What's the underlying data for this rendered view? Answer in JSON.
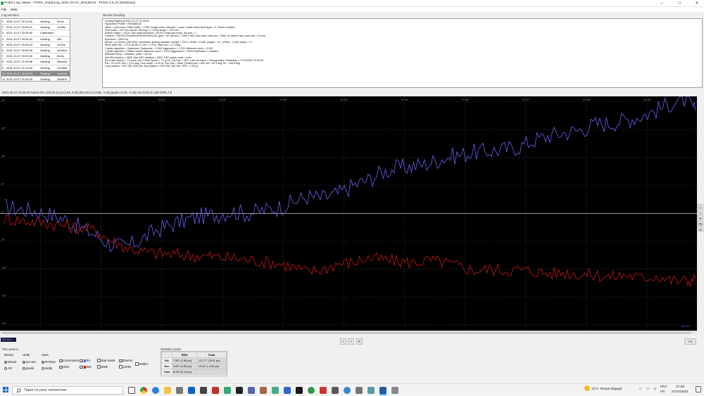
{
  "window": {
    "title": "PHD2 Log Viewer - PHD2_GuideLog_2021-10-27_201155.txt - PHD2 2.6.10 (Windows)",
    "minimize": "–",
    "maximize": "□",
    "close": "✕"
  },
  "menu": [
    "File",
    "Help"
  ],
  "log_sections": {
    "label": "Log sections",
    "rows": [
      {
        "n": "1",
        "date": "2021-10-27 20:11:46",
        "type": "Guiding",
        "dur": "5m1s"
      },
      {
        "n": "2",
        "date": "2021-10-27 20:26:41",
        "type": "Guiding",
        "dur": "1m35s"
      },
      {
        "n": "3",
        "date": "2021-10-27 20:28:40",
        "type": "Calibration",
        "dur": ""
      },
      {
        "n": "4",
        "date": "2021-10-27 20:34:31",
        "type": "Guiding",
        "dur": "46s"
      },
      {
        "n": "5",
        "date": "2021-10-27 20:35:23",
        "type": "Guiding",
        "dur": "1m13s"
      },
      {
        "n": "6",
        "date": "2021-10-27 20:36:45",
        "type": "Guiding",
        "dur": "16m31s"
      },
      {
        "n": "7",
        "date": "2021-10-27 20:53:49",
        "type": "Guiding",
        "dur": "5m2s"
      },
      {
        "n": "8",
        "date": "2021-10-27 21:00:56",
        "type": "Guiding",
        "dur": "18m43s"
      },
      {
        "n": "9",
        "date": "2021-10-27 21:12:00",
        "type": "Guiding",
        "dur": "12m58s"
      },
      {
        "n": "10",
        "date": "2021-10-27 21:28:24",
        "type": "Guiding",
        "dur": "11m24s"
      },
      {
        "n": "11",
        "date": "2021-10-27 21:40:23",
        "type": "Guiding",
        "dur": "15m57s"
      }
    ],
    "selected_index": 9
  },
  "section_heading": {
    "label": "Section heading",
    "lines": [
      "Guiding Begins at 2021-10-27 21:28:24",
      "Equipment Profile = RASA8/EAC",
      "Dither = both axes, Dither scale = 1.000, Image noise reduction = none, Guide-frame time lapse = 0, Server enabled",
      "Pixel scale = 3.87 arc-sec/px, Binning = 1, Focal length = 200 mm",
      "Search region = 15 px, Star mass tolerance = 50.0%, Multi-star mode, list size = 1",
      "Camera = QHY5LII-M (fake/ASI/ZWO/ASI120), gain = 40, full size = 1280 x 960, have dark, dark dur = 2500, no defect map, pixel size = 3.8 um",
      "Exposure = 2500 ms",
      "Mount = Un Driver (ASCOM), connected, guiding disabled, xAngle = 152.9, xRate = 0.528, yAngle = 11°, yRate = 1.444, parity = +/+",
      "Norm rates RA = 2.0\"/s @ dec 0, Dec = 0.4\"/s, offset set = 17.4 deg",
      "X guide algorithm = Hysteresis, Hysteresis = 0.000, Aggression = 0.700, Minimum move = 0.250",
      "Y guide algorithm = Resist Switch, Minimum move = 0.910 Aggression = 100% FastSwitch = enabled",
      "Backlash comp = disabled, pulse = 20 ms",
      "Max RA duration = 2500, Max DEC duration = 2500, DEC guide mode = Auto",
      "RA Guide Speed = 7.5 a-s/s, Dec Guide Speed = 7.5 a-s/s, Cal Dec = 28.0, Last Cal Issue = Orthogonality, Timestamp = 27/10/2021 20:34:30",
      "RA = 22.18 hr, Dec = 12.9 deg, Hour angle = 0.49 hr, Pier side = West, Rotator pos = N/A, Alt = 52.3 deg, Az = 169.8 deg",
      "Lock position = 597.206, 328.159, Star position = 597.206, 328.159, HFD = 2.33 px"
    ]
  },
  "chart_status": "2021-10-27 21:32:16 Frame 93 t=232.60 (x,y)=(2.84, 6.83) (RA,Dec)=(-0.66, -2.44) guide (-0.43, -2.44) corr (0.0) m=126 SNR=7.6",
  "chart_data": {
    "type": "line",
    "x_ticks": [
      "21:29",
      "21:30",
      "21:31",
      "21:32",
      "21:33",
      "21:34",
      "21:35",
      "21:36",
      "21:37",
      "21:38",
      "21:39"
    ],
    "y_ticks": [
      "20\"",
      "15\"",
      "10\"",
      "5\"",
      "0\"",
      "-5\"",
      "-10\"",
      "-15\"",
      "-20\""
    ],
    "ylim": [
      -20,
      20
    ],
    "x_range": [
      "21:28:24",
      "21:39:48"
    ],
    "grid": true,
    "series": [
      {
        "key": "RA",
        "color": "#6a62f2",
        "t_min": [
          0,
          0.25,
          0.5,
          0.75,
          1,
          1.25,
          1.5,
          1.75,
          2,
          2.25,
          2.5,
          2.75,
          3,
          3.25,
          3.5,
          3.75,
          4,
          4.25,
          4.5,
          4.75,
          5,
          5.25,
          5.5,
          5.75,
          6,
          6.25,
          6.5,
          6.75,
          7,
          7.25,
          7.5,
          7.75,
          8,
          8.25,
          8.5,
          8.75,
          9,
          9.25,
          9.5,
          9.75,
          10,
          10.25,
          10.5,
          10.75,
          11,
          11.25,
          11.4
        ],
        "values": [
          1.2,
          0.8,
          0.5,
          -0.2,
          -1.0,
          -2.5,
          -3.8,
          -5.5,
          -6.0,
          -4.8,
          -3.0,
          -2.0,
          -1.2,
          -0.5,
          -0.2,
          0.4,
          0.0,
          0.5,
          1.0,
          2.0,
          3.0,
          2.8,
          3.5,
          5.0,
          6.0,
          7.5,
          8.2,
          8.5,
          9.0,
          10.0,
          10.5,
          11.0,
          11.2,
          11.5,
          12.0,
          13.2,
          14.0,
          14.5,
          15.0,
          16.0,
          16.2,
          16.8,
          17.5,
          18.5,
          19.8,
          20.5,
          18.5
        ]
      },
      {
        "key": "Dec",
        "color": "#c81818",
        "t_min": [
          0,
          0.25,
          0.5,
          0.75,
          1,
          1.25,
          1.5,
          1.75,
          2,
          2.25,
          2.5,
          2.75,
          3,
          3.25,
          3.5,
          3.75,
          4,
          4.25,
          4.5,
          4.75,
          5,
          5.25,
          5.5,
          5.75,
          6,
          6.25,
          6.5,
          6.75,
          7,
          7.25,
          7.5,
          7.75,
          8,
          8.25,
          8.5,
          8.75,
          9,
          9.25,
          9.5,
          9.75,
          10,
          10.25,
          10.5,
          10.75,
          11,
          11.25,
          11.4
        ],
        "values": [
          -1.0,
          -1.2,
          -1.5,
          -1.8,
          -2.2,
          -2.6,
          -3.0,
          -4.8,
          -6.0,
          -6.8,
          -7.2,
          -7.3,
          -7.5,
          -7.6,
          -7.8,
          -8.0,
          -8.3,
          -8.6,
          -8.9,
          -9.6,
          -10.5,
          -10.0,
          -9.0,
          -8.8,
          -8.0,
          -8.3,
          -8.6,
          -8.8,
          -8.4,
          -8.8,
          -9.5,
          -10.2,
          -10.0,
          -10.2,
          -10.1,
          -10.4,
          -10.8,
          -10.6,
          -10.9,
          -11.0,
          -11.4,
          -11.0,
          -11.6,
          -11.2,
          -12.0,
          -12.2,
          -11.8
        ]
      }
    ]
  },
  "right_buttons": [
    "<",
    ">",
    "R",
    "P2",
    "D"
  ],
  "legend_badge": "RA Dec",
  "nav_buttons": [
    "<",
    ">",
    "R"
  ],
  "fit_button": "Fit",
  "plot_options": {
    "label": "Plot options",
    "device_label": "Device",
    "device_mount": "Mount",
    "device_ao": "AO",
    "units_label": "Units",
    "units_arcsec": "arc-sec",
    "units_pixels": "pixels",
    "axes_label": "Axes",
    "axes_radec": "RA/Dec",
    "axes_dxdy": "dx/dy",
    "corrections": "Corrections",
    "grid": "Grid",
    "ra": "RA",
    "dec": "Dec",
    "star_mass": "Star mass",
    "snr": "SNR",
    "events": "Events",
    "limits": "Limits",
    "settler": "Settler"
  },
  "statistics": {
    "label": "Statistics",
    "unit": "(0x0)",
    "headers": [
      "",
      "RMS",
      "Peak"
    ],
    "rows": [
      {
        "name": "RA",
        "rms": "7.55\" (1.95 px)",
        "peak": "-21.77\" (-5.61 px)"
      },
      {
        "name": "Dec",
        "rms": "3.52\" (0.95 px)",
        "peak": "13.14\" (-3.39 px)"
      },
      {
        "name": "Total",
        "rms": "8.25\" (2.13 px)",
        "peak": ""
      }
    ]
  },
  "taskbar": {
    "search_placeholder": "Taper ici pour rechercher",
    "weather": "13°C  Temps dégagé",
    "lang_top": "FRA",
    "lang_bottom": "FR",
    "time": "27:06",
    "date": "27/10/2021"
  }
}
